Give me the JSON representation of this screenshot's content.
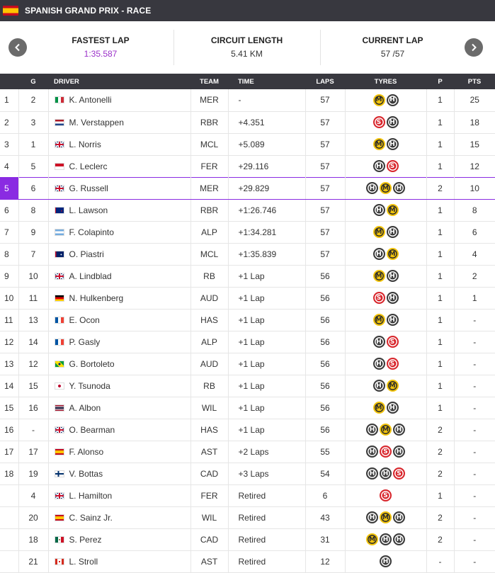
{
  "header": {
    "title": "SPANISH GRAND PRIX - RACE",
    "flag": "ES"
  },
  "summary": {
    "fastest_lap_label": "FASTEST LAP",
    "fastest_lap_value": "1:35.587",
    "circuit_length_label": "CIRCUIT LENGTH",
    "circuit_length_value": "5.41 KM",
    "current_lap_label": "CURRENT LAP",
    "current_lap_value": "57 /57"
  },
  "columns": {
    "pos": "",
    "grid": "G",
    "driver": "DRIVER",
    "team": "TEAM",
    "time": "TIME",
    "laps": "LAPS",
    "tyres": "TYRES",
    "pits": "P",
    "pts": "PTS"
  },
  "colors": {
    "header_bg": "#38383f",
    "highlight": "#8a2be2",
    "fastest_lap": "#9b30c9",
    "medium": "#f2c40c",
    "hard": "#3a3a3a",
    "soft": "#d8262c"
  },
  "rows": [
    {
      "pos": "1",
      "grid": "2",
      "flag": "IT",
      "driver": "K. Antonelli",
      "team": "MER",
      "time": "-",
      "laps": "57",
      "tyres": [
        "M",
        "H"
      ],
      "pits": "1",
      "pts": "25"
    },
    {
      "pos": "2",
      "grid": "3",
      "flag": "NL",
      "driver": "M. Verstappen",
      "team": "RBR",
      "time": "+4.351",
      "laps": "57",
      "tyres": [
        "S",
        "H"
      ],
      "pits": "1",
      "pts": "18"
    },
    {
      "pos": "3",
      "grid": "1",
      "flag": "GB",
      "driver": "L. Norris",
      "team": "MCL",
      "time": "+5.089",
      "laps": "57",
      "tyres": [
        "M",
        "H"
      ],
      "pits": "1",
      "pts": "15"
    },
    {
      "pos": "4",
      "grid": "5",
      "flag": "MC",
      "driver": "C. Leclerc",
      "team": "FER",
      "time": "+29.116",
      "laps": "57",
      "tyres": [
        "H",
        "S"
      ],
      "pits": "1",
      "pts": "12"
    },
    {
      "pos": "5",
      "grid": "6",
      "flag": "GB",
      "driver": "G. Russell",
      "team": "MER",
      "time": "+29.829",
      "laps": "57",
      "tyres": [
        "H",
        "M",
        "H"
      ],
      "pits": "2",
      "pts": "10",
      "highlight": true
    },
    {
      "pos": "6",
      "grid": "8",
      "flag": "NZ",
      "driver": "L. Lawson",
      "team": "RBR",
      "time": "+1:26.746",
      "laps": "57",
      "tyres": [
        "H",
        "M"
      ],
      "pits": "1",
      "pts": "8"
    },
    {
      "pos": "7",
      "grid": "9",
      "flag": "AR",
      "driver": "F. Colapinto",
      "team": "ALP",
      "time": "+1:34.281",
      "laps": "57",
      "tyres": [
        "M",
        "H"
      ],
      "pits": "1",
      "pts": "6"
    },
    {
      "pos": "8",
      "grid": "7",
      "flag": "AU",
      "driver": "O. Piastri",
      "team": "MCL",
      "time": "+1:35.839",
      "laps": "57",
      "tyres": [
        "H",
        "M"
      ],
      "pits": "1",
      "pts": "4"
    },
    {
      "pos": "9",
      "grid": "10",
      "flag": "GB",
      "driver": "A. Lindblad",
      "team": "RB",
      "time": "+1 Lap",
      "laps": "56",
      "tyres": [
        "M",
        "H"
      ],
      "pits": "1",
      "pts": "2"
    },
    {
      "pos": "10",
      "grid": "11",
      "flag": "DE",
      "driver": "N. Hulkenberg",
      "team": "AUD",
      "time": "+1 Lap",
      "laps": "56",
      "tyres": [
        "S",
        "H"
      ],
      "pits": "1",
      "pts": "1"
    },
    {
      "pos": "11",
      "grid": "13",
      "flag": "FR",
      "driver": "E. Ocon",
      "team": "HAS",
      "time": "+1 Lap",
      "laps": "56",
      "tyres": [
        "M",
        "H"
      ],
      "pits": "1",
      "pts": "-"
    },
    {
      "pos": "12",
      "grid": "14",
      "flag": "FR",
      "driver": "P. Gasly",
      "team": "ALP",
      "time": "+1 Lap",
      "laps": "56",
      "tyres": [
        "H",
        "S"
      ],
      "pits": "1",
      "pts": "-"
    },
    {
      "pos": "13",
      "grid": "12",
      "flag": "BR",
      "driver": "G. Bortoleto",
      "team": "AUD",
      "time": "+1 Lap",
      "laps": "56",
      "tyres": [
        "H",
        "S"
      ],
      "pits": "1",
      "pts": "-"
    },
    {
      "pos": "14",
      "grid": "15",
      "flag": "JP",
      "driver": "Y. Tsunoda",
      "team": "RB",
      "time": "+1 Lap",
      "laps": "56",
      "tyres": [
        "H",
        "M"
      ],
      "pits": "1",
      "pts": "-"
    },
    {
      "pos": "15",
      "grid": "16",
      "flag": "TH",
      "driver": "A. Albon",
      "team": "WIL",
      "time": "+1 Lap",
      "laps": "56",
      "tyres": [
        "M",
        "H"
      ],
      "pits": "1",
      "pts": "-"
    },
    {
      "pos": "16",
      "grid": "-",
      "flag": "GB",
      "driver": "O. Bearman",
      "team": "HAS",
      "time": "+1 Lap",
      "laps": "56",
      "tyres": [
        "H",
        "M",
        "H"
      ],
      "pits": "2",
      "pts": "-"
    },
    {
      "pos": "17",
      "grid": "17",
      "flag": "ES",
      "driver": "F. Alonso",
      "team": "AST",
      "time": "+2 Laps",
      "laps": "55",
      "tyres": [
        "H",
        "S",
        "H"
      ],
      "pits": "2",
      "pts": "-"
    },
    {
      "pos": "18",
      "grid": "19",
      "flag": "FI",
      "driver": "V. Bottas",
      "team": "CAD",
      "time": "+3 Laps",
      "laps": "54",
      "tyres": [
        "H",
        "H",
        "S"
      ],
      "pits": "2",
      "pts": "-"
    },
    {
      "pos": "",
      "grid": "4",
      "flag": "GB",
      "driver": "L. Hamilton",
      "team": "FER",
      "time": "Retired",
      "laps": "6",
      "tyres": [
        "S"
      ],
      "pits": "1",
      "pts": "-"
    },
    {
      "pos": "",
      "grid": "20",
      "flag": "ES",
      "driver": "C. Sainz Jr.",
      "team": "WIL",
      "time": "Retired",
      "laps": "43",
      "tyres": [
        "H",
        "M",
        "H"
      ],
      "pits": "2",
      "pts": "-"
    },
    {
      "pos": "",
      "grid": "18",
      "flag": "MX",
      "driver": "S. Perez",
      "team": "CAD",
      "time": "Retired",
      "laps": "31",
      "tyres": [
        "M",
        "H",
        "H"
      ],
      "pits": "2",
      "pts": "-"
    },
    {
      "pos": "",
      "grid": "21",
      "flag": "CA",
      "driver": "L. Stroll",
      "team": "AST",
      "time": "Retired",
      "laps": "12",
      "tyres": [
        "H"
      ],
      "pits": "-",
      "pts": "-"
    }
  ]
}
